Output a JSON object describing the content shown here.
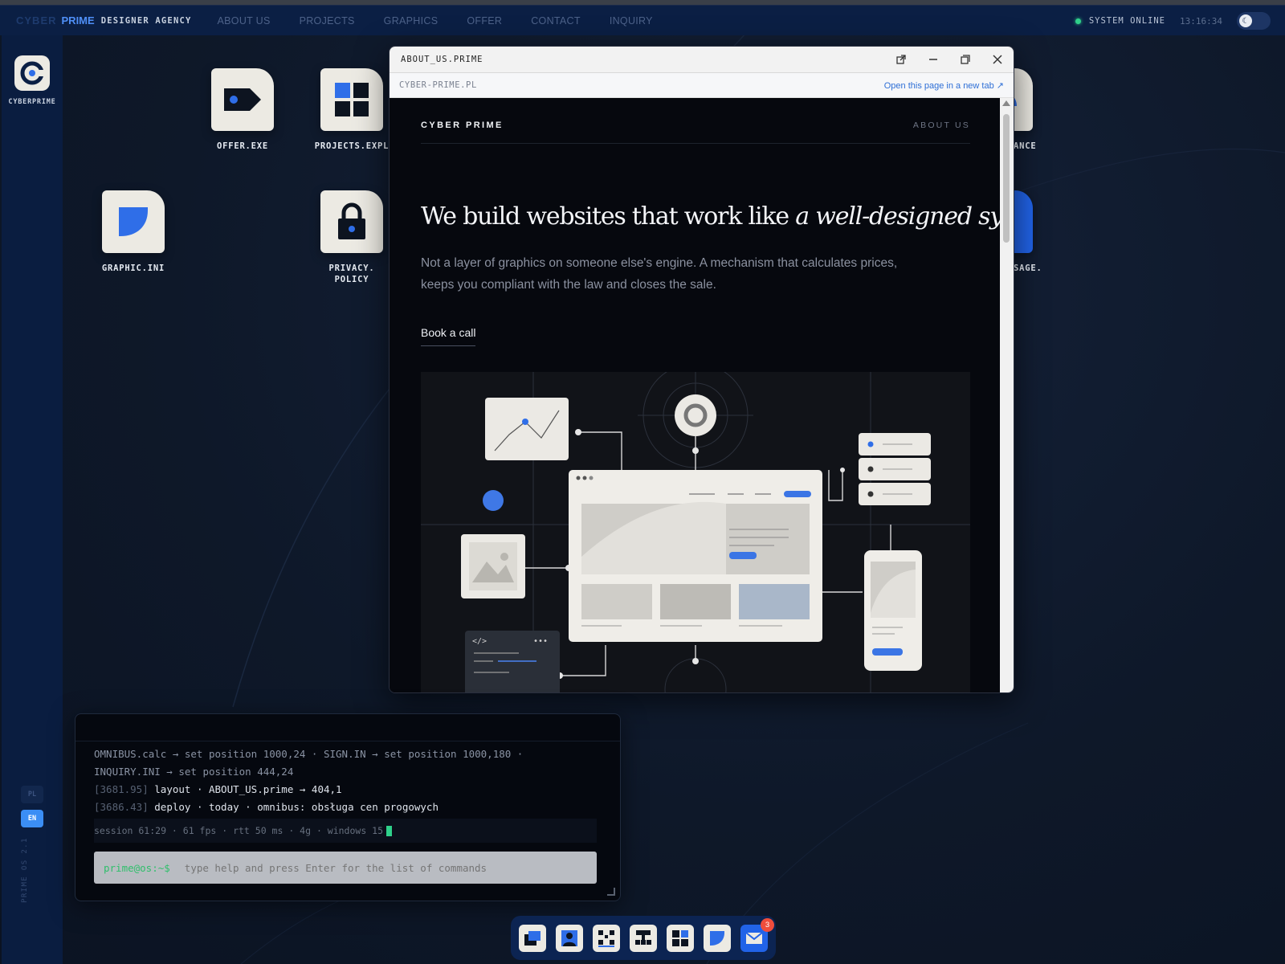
{
  "topbar": {
    "brand_cyber": "CYBER",
    "brand_prime": "PRIME",
    "brand_agency": "DESIGNER AGENCY",
    "nav": [
      "ABOUT US",
      "PROJECTS",
      "GRAPHICS",
      "OFFER",
      "CONTACT",
      "INQUIRY"
    ],
    "status_text": "SYSTEM ONLINE",
    "clock": "13:16:34",
    "colors": {
      "bar": "#0b1f44",
      "accent": "#4f8ff7",
      "status": "#2fd08a"
    }
  },
  "sidebar": {
    "logo_label": "CYBERPRIME",
    "lang_pl": "PL",
    "lang_en": "EN",
    "os_version": "PRIME OS 2.1"
  },
  "desktop_icons": [
    {
      "label": "OFFER.EXE",
      "icon": "tag-icon"
    },
    {
      "label": "PROJECTS.EXPL",
      "icon": "grid-icon"
    },
    {
      "label": "GRAPHIC.INI",
      "icon": "leaf-icon"
    },
    {
      "label": "PRIVACY.\nPOLICY",
      "icon": "lock-icon"
    },
    {
      "label": "ANCE",
      "icon": "gauge-icon"
    },
    {
      "label": "SAGE.",
      "icon": "message-icon"
    }
  ],
  "browser": {
    "title": "ABOUT_US.PRIME",
    "url": "CYBER-PRIME.PL",
    "open_new_tab": "Open this page in a new tab ↗",
    "page": {
      "brand": "CYBER PRIME",
      "nav_link": "ABOUT US",
      "hero_title_plain": "We build websites that work like ",
      "hero_title_italic": "a well-designed system.",
      "hero_sub": "Not a layer of graphics on someone else's engine. A mechanism that calculates prices, keeps you compliant with the law and closes the sale.",
      "cta": "Book a call"
    }
  },
  "terminal": {
    "lines": [
      {
        "ts": "",
        "text": "OMNIBUS.calc → set position 1000,24 · SIGN.IN → set position 1000,180 ·"
      },
      {
        "ts": "",
        "text": "INQUIRY.INI → set position 444,24"
      },
      {
        "ts": "[3681.95]",
        "text": "layout · ABOUT_US.prime → 404,1"
      },
      {
        "ts": "[3686.43]",
        "text": "deploy · today · omnibus: obsługa cen progowych"
      }
    ],
    "status": "session 61:29 · 61 fps · rtt 50 ms · 4g · windows 15",
    "prompt": "prime@os:~$",
    "placeholder": "type help and press Enter for the list of commands"
  },
  "dock": {
    "items": [
      "windows-icon",
      "user-icon",
      "qr-icon",
      "sitemap-icon",
      "grid-icon",
      "leaf-icon",
      "mail-icon"
    ],
    "mail_badge": "3"
  }
}
